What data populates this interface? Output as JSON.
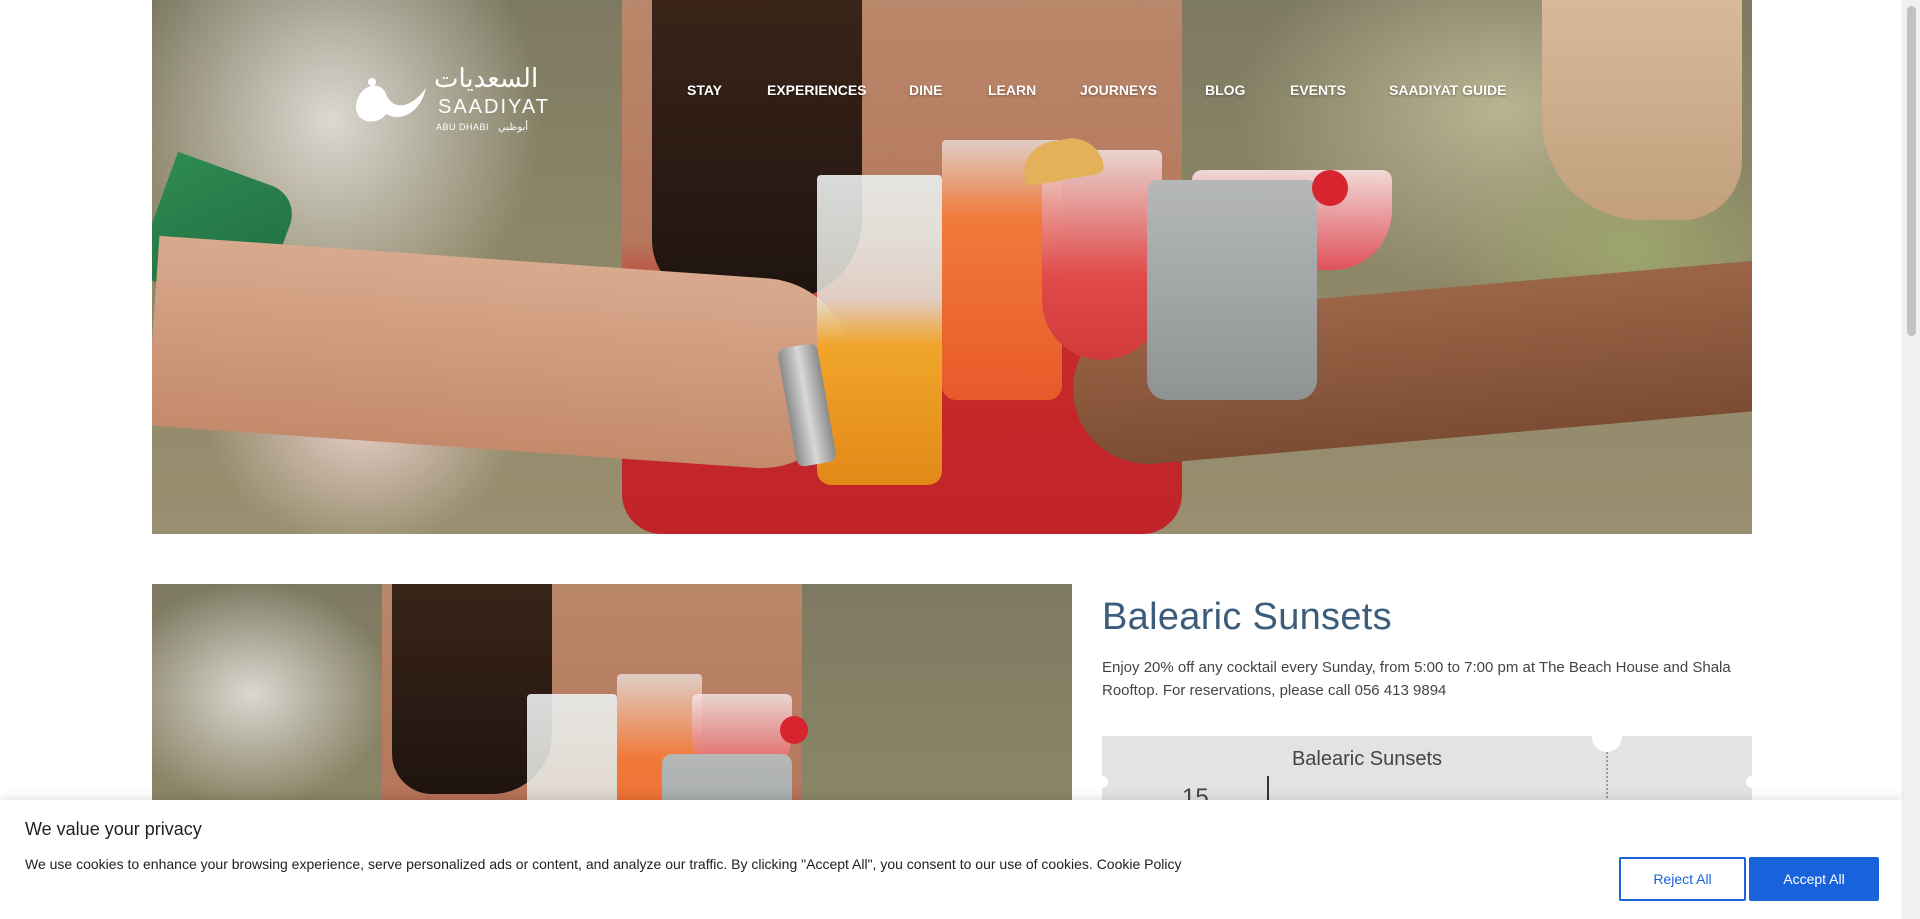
{
  "brand": {
    "arabic": "السعديات",
    "name": "SAADIYAT",
    "sub_en": "ABU DHABI",
    "sub_ar": "أبوظبي"
  },
  "nav": {
    "items": [
      {
        "label": "STAY"
      },
      {
        "label": "EXPERIENCES"
      },
      {
        "label": "DINE"
      },
      {
        "label": "LEARN"
      },
      {
        "label": "JOURNEYS"
      },
      {
        "label": "BLOG"
      },
      {
        "label": "EVENTS"
      },
      {
        "label": "SAADIYAT GUIDE"
      }
    ]
  },
  "event": {
    "title": "Balearic Sunsets",
    "description": "Enjoy 20% off any cocktail every Sunday, from 5:00 to 7:00 pm at The Beach House and Shala Rooftop. For reservations, please call 056 413 9894",
    "ticket": {
      "title": "Balearic Sunsets",
      "day": "15"
    }
  },
  "cookie": {
    "title": "We value your privacy",
    "text": "We use cookies to enhance your browsing experience, serve personalized ads or content, and analyze our traffic. By clicking \"Accept All\", you consent to our use of cookies.",
    "link": "Cookie Policy",
    "reject_label": "Reject All",
    "accept_label": "Accept All"
  },
  "colors": {
    "title_blue": "#3b5d7b",
    "button_blue": "#1863dc",
    "ticket_bg": "#e3e3e3"
  }
}
